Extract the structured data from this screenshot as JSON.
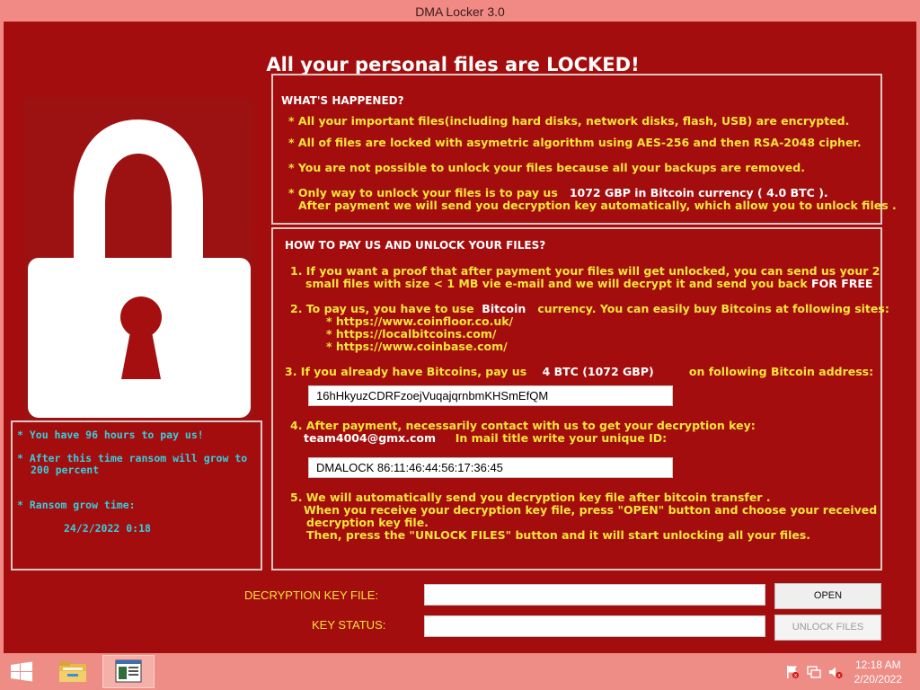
{
  "window": {
    "title": "DMA Locker 3.0",
    "headline": "All your personal files are LOCKED!"
  },
  "whats_happened": {
    "heading": "WHAT'S HAPPENED?",
    "line1": "* All your important files(including hard disks, network disks, flash, USB) are encrypted.",
    "line2": "* All of files are locked with asymetric algorithm using AES-256 and then RSA-2048 cipher.",
    "line3": "* You are not possible to unlock your files because all your backups are removed.",
    "line4_pre": "* Only way to unlock your files is to pay us",
    "line4_amount": "1072 GBP in Bitcoin currency ( 4.0 BTC ).",
    "line5": "After payment we will send you decryption key automatically, which allow you to unlock files ."
  },
  "how_to_pay": {
    "heading": "HOW TO PAY US AND UNLOCK YOUR FILES?",
    "step1_line1": "1. If you want a proof that after payment your files will get unlocked, you can send us your 2",
    "step1_line2": "small files with size < 1 MB vie e-mail and we will decrypt it and send you back",
    "step1_free": "FOR FREE",
    "step2_pre": "2. To pay us, you have to use",
    "step2_bitcoin": "Bitcoin",
    "step2_post": "currency. You can easily buy Bitcoins at following sites:",
    "sites": [
      "* https://www.coinfloor.co.uk/",
      "* https://localbitcoins.com/",
      "* https://www.coinbase.com/"
    ],
    "step3_pre": "3. If you already have Bitcoins, pay us",
    "step3_amount": "4 BTC (1072 GBP)",
    "step3_post": "on following Bitcoin address:",
    "bitcoin_address": "16hHkyuzCDRFzoejVuqajqrnbmKHSmEfQM",
    "step4_line1": "4. After payment, necessarily contact with us to get your decryption key:",
    "email": "team4004@gmx.com",
    "step4_title": "In mail title write your unique ID:",
    "unique_id": "DMALOCK 86:11:46:44:56:17:36:45",
    "step5_line1": "5. We will automatically send you decryption key file after bitcoin transfer .",
    "step5_line2": "When you receive your decryption key file, press \"OPEN\"  button and choose your received",
    "step5_line3": "decryption key file.",
    "step5_line4": "Then,  press the \"UNLOCK FILES\" button and it will start unlocking all your files."
  },
  "timer": {
    "line1": "* You have 96 hours to pay us!",
    "line2": "* After this time ransom will grow to",
    "line3": "200 percent",
    "line4": "* Ransom grow time:",
    "date": "24/2/2022 0:18"
  },
  "form": {
    "key_file_label": "DECRYPTION KEY FILE:",
    "key_file_value": "",
    "open_label": "OPEN",
    "key_status_label": "KEY STATUS:",
    "key_status_value": "",
    "unlock_label": "UNLOCK FILES"
  },
  "taskbar": {
    "time": "12:18 AM",
    "date": "2/20/2022",
    "icons": [
      "windows-start-icon",
      "file-explorer-icon",
      "dma-locker-app-icon",
      "action-center-flag-icon",
      "network-icon",
      "volume-muted-icon"
    ]
  },
  "colors": {
    "window_bg": "#a30d0d",
    "text_yellow": "#f6e43a",
    "text_cyan": "#35cfe0",
    "frame": "#f18a84"
  }
}
